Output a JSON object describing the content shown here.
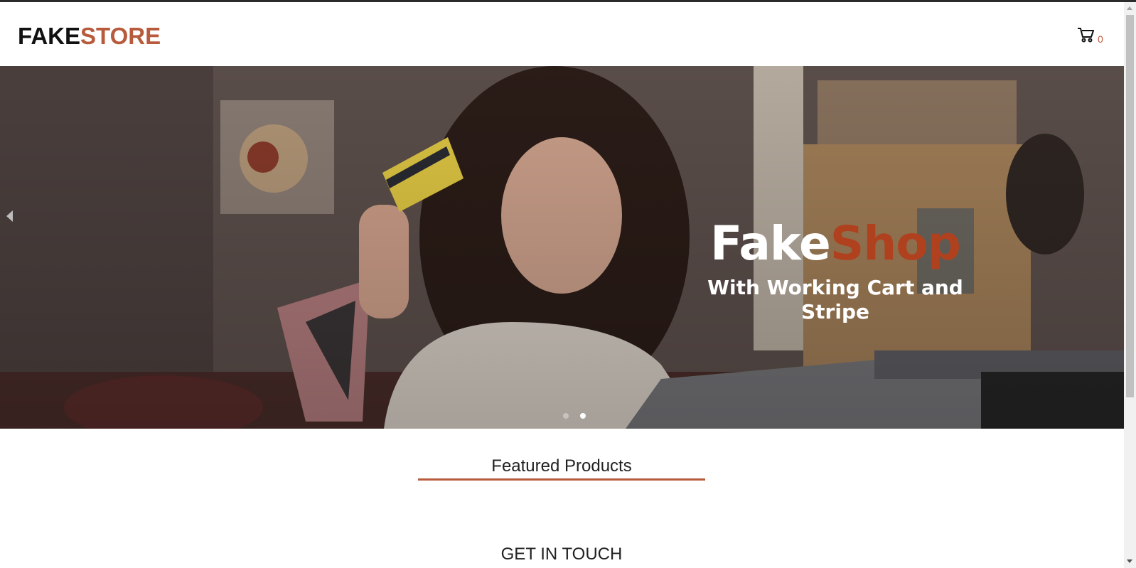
{
  "brand": {
    "part1": "FAKE",
    "part2": "STORE"
  },
  "cart": {
    "count": "0",
    "icon": "cart-icon"
  },
  "hero": {
    "title_part1": "Fake",
    "title_part2": "Shop",
    "subtitle": "With Working Cart and Stripe",
    "slide_count": 2,
    "active_slide": 2
  },
  "sections": {
    "featured": "Featured Products",
    "contact": "GET IN TOUCH"
  },
  "colors": {
    "accent": "#b85a3c",
    "hero_accent": "#b0411f",
    "dark": "#111111"
  }
}
